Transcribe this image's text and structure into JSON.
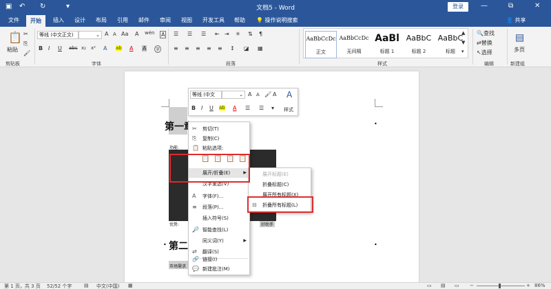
{
  "window": {
    "title": "文档5 - Word",
    "login": "登录",
    "minimize": "—",
    "restore": "⧉",
    "close": "✕"
  },
  "quick_access": {
    "save": "▣",
    "undo": "↶",
    "redo": "↻",
    "customize": "▾"
  },
  "tabs": [
    "文件",
    "开始",
    "插入",
    "设计",
    "布局",
    "引用",
    "邮件",
    "审阅",
    "视图",
    "开发工具",
    "帮助"
  ],
  "active_tab": "开始",
  "tell_me": "操作说明搜索",
  "share": "共享",
  "ribbon": {
    "clipboard": {
      "label": "剪贴板",
      "paste": "粘贴"
    },
    "font": {
      "label": "字体",
      "font_name": "等线 (中文正文)",
      "font_size": "",
      "bold": "B",
      "italic": "I",
      "underline": "U",
      "strike": "abc",
      "subscript": "x₂",
      "superscript": "x²",
      "grow": "A",
      "shrink": "A",
      "case": "Aa",
      "clear": "A",
      "phonetic": "wén",
      "border": "A"
    },
    "paragraph": {
      "label": "段落"
    },
    "styles": {
      "label": "样式",
      "items": [
        {
          "preview": "AaBbCcDc",
          "name": "正文"
        },
        {
          "preview": "AaBbCcDc",
          "name": "无间隔"
        },
        {
          "preview": "AaBl",
          "name": "标题 1"
        },
        {
          "preview": "AaBbC",
          "name": "标题 2"
        },
        {
          "preview": "AaBbC",
          "name": "标题"
        }
      ]
    },
    "editing": {
      "label": "编辑",
      "find": "查找",
      "replace": "替换",
      "select": "选择"
    },
    "new_group": {
      "label": "新建组",
      "multipage": "多页"
    }
  },
  "document": {
    "heading1": "第一章",
    "heading2": "第二",
    "line_func": "功能:",
    "line_adv": "优势:",
    "line_adv_tail": "好助手",
    "line_market": "市场需求"
  },
  "mini_toolbar": {
    "font": "等线 (中文",
    "size": "",
    "bold": "B",
    "italic": "I",
    "underline": "U",
    "styles": "样式"
  },
  "context_menu": {
    "items": [
      {
        "icon": "✂",
        "label": "剪切(T)"
      },
      {
        "icon": "⎘",
        "label": "复制(C)"
      },
      {
        "icon": "📋",
        "label": "粘贴选项:"
      },
      {
        "icon": "",
        "label": "展开/折叠(E)"
      },
      {
        "icon": "",
        "label": "汉字重选(V)"
      },
      {
        "icon": "A",
        "label": "字体(F)..."
      },
      {
        "icon": "≡",
        "label": "段落(P)..."
      },
      {
        "icon": "",
        "label": "插入符号(S)"
      },
      {
        "icon": "🔎",
        "label": "智能查找(L)"
      },
      {
        "icon": "",
        "label": "同义词(Y)"
      },
      {
        "icon": "⇄",
        "label": "翻译(S)"
      },
      {
        "icon": "🔗",
        "label": "链接(I)"
      },
      {
        "icon": "💬",
        "label": "新建批注(M)"
      }
    ]
  },
  "submenu": {
    "items": [
      {
        "label": "展开标题(E)",
        "disabled": true
      },
      {
        "label": "折叠标题(C)",
        "disabled": false
      },
      {
        "label": "展开所有标题(X)",
        "disabled": false
      },
      {
        "label": "折叠所有标题(L)",
        "disabled": false
      }
    ]
  },
  "status_bar": {
    "page": "第 1 页，共 3 页",
    "words": "52/52 个字",
    "language": "中文(中国)",
    "zoom": "86%"
  }
}
